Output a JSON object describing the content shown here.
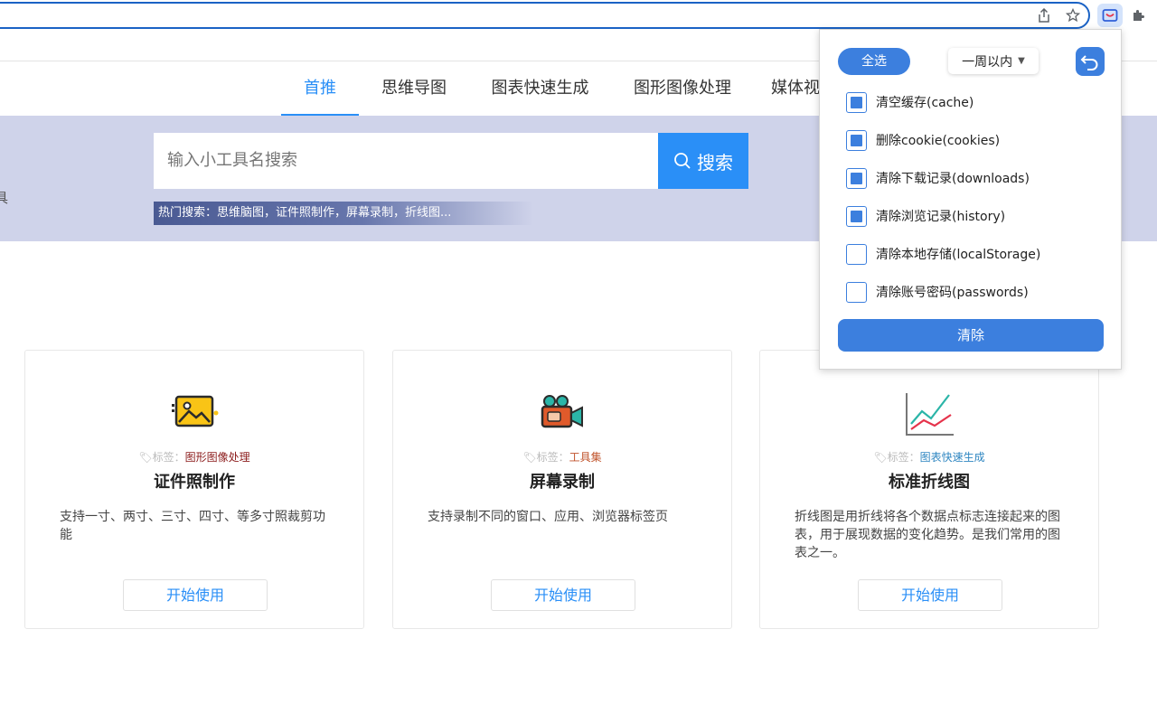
{
  "browser": {
    "icons": [
      "share-icon",
      "star-icon",
      "extension-cleaner-icon",
      "puzzle-icon"
    ]
  },
  "nav": {
    "tabs": [
      {
        "label": "首推",
        "active": true
      },
      {
        "label": "思维导图",
        "active": false
      },
      {
        "label": "图表快速生成",
        "active": false
      },
      {
        "label": "图形图像处理",
        "active": false
      },
      {
        "label": "媒体视",
        "active": false
      }
    ]
  },
  "hero": {
    "edge_text": "具",
    "search_placeholder": "输入小工具名搜索",
    "search_button": "搜索",
    "hot_search": "热门搜索：思维脑图，证件照制作，屏幕录制，折线图..."
  },
  "cards": [
    {
      "tag_prefix": "标签：",
      "tag": "图形图像处理",
      "tag_color": "#8b1a1a",
      "title": "证件照制作",
      "desc": "支持一寸、两寸、三寸、四寸、等多寸照裁剪功能",
      "button": "开始使用",
      "icon": "image-icon"
    },
    {
      "tag_prefix": "标签：",
      "tag": "工具集",
      "tag_color": "#c0532b",
      "title": "屏幕录制",
      "desc": "支持录制不同的窗口、应用、浏览器标签页",
      "button": "开始使用",
      "icon": "video-camera-icon"
    },
    {
      "tag_prefix": "标签：",
      "tag": "图表快速生成",
      "tag_color": "#2e86c1",
      "title": "标准折线图",
      "desc": "折线图是用折线将各个数据点标志连接起来的图表，用于展现数据的变化趋势。是我们常用的图表之一。",
      "button": "开始使用",
      "icon": "line-chart-icon"
    }
  ],
  "popup": {
    "select_all": "全选",
    "range": "一周以内",
    "options": [
      {
        "label": "清空缓存(cache)",
        "checked": true
      },
      {
        "label": "删除cookie(cookies)",
        "checked": true
      },
      {
        "label": "清除下载记录(downloads)",
        "checked": true
      },
      {
        "label": "清除浏览记录(history)",
        "checked": true
      },
      {
        "label": "清除本地存储(localStorage)",
        "checked": false
      },
      {
        "label": "清除账号密码(passwords)",
        "checked": false
      }
    ],
    "clear_button": "清除",
    "accent": "#3c7fde"
  }
}
